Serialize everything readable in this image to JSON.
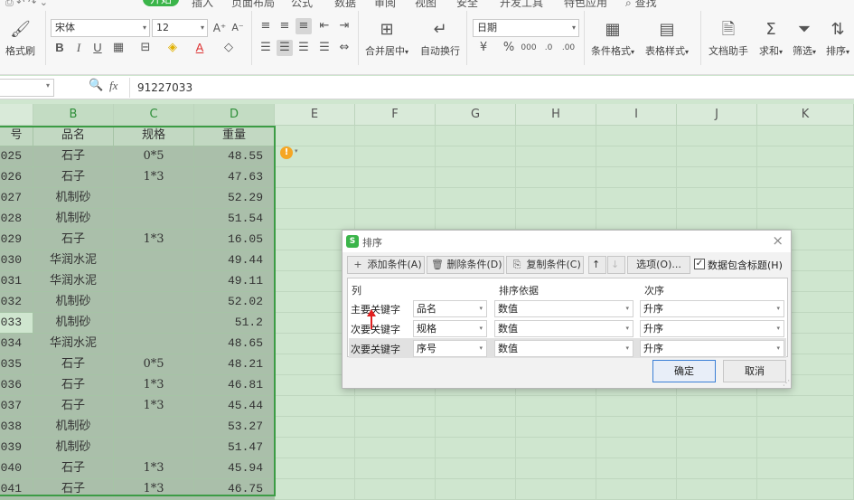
{
  "menu": {
    "tabs": [
      "开始",
      "插入",
      "页面布局",
      "公式",
      "数据",
      "审阅",
      "视图",
      "安全",
      "开发工具",
      "特色应用"
    ],
    "search": "查找"
  },
  "ribbon": {
    "format_painter": "格式刷",
    "font_name": "宋体",
    "font_size": "12",
    "merge_center": "合并居中",
    "wrap_text": "自动换行",
    "number_format": "日期",
    "conditional_format": "条件格式",
    "table_style": "表格样式",
    "doc_assistant": "文档助手",
    "sum": "求和",
    "filter": "筛选",
    "sort": "排序"
  },
  "formula_bar": {
    "fx": "fx",
    "value": "91227033"
  },
  "sheet": {
    "columns": [
      "B",
      "C",
      "D",
      "E",
      "F",
      "G",
      "H",
      "I",
      "J",
      "K"
    ],
    "headers": [
      "号",
      "品名",
      "规格",
      "重量"
    ],
    "rows": [
      [
        "025",
        "石子",
        "0*5",
        "48.55"
      ],
      [
        "026",
        "石子",
        "1*3",
        "47.63"
      ],
      [
        "027",
        "机制砂",
        "",
        "52.29"
      ],
      [
        "028",
        "机制砂",
        "",
        "51.54"
      ],
      [
        "029",
        "石子",
        "1*3",
        "16.05"
      ],
      [
        "030",
        "华润水泥",
        "",
        "49.44"
      ],
      [
        "031",
        "华润水泥",
        "",
        "49.11"
      ],
      [
        "032",
        "机制砂",
        "",
        "52.02"
      ],
      [
        "033",
        "机制砂",
        "",
        "51.2"
      ],
      [
        "034",
        "华润水泥",
        "",
        "48.65"
      ],
      [
        "035",
        "石子",
        "0*5",
        "48.21"
      ],
      [
        "036",
        "石子",
        "1*3",
        "46.81"
      ],
      [
        "037",
        "石子",
        "1*3",
        "45.44"
      ],
      [
        "038",
        "机制砂",
        "",
        "53.27"
      ],
      [
        "039",
        "机制砂",
        "",
        "51.47"
      ],
      [
        "040",
        "石子",
        "1*3",
        "45.94"
      ],
      [
        "041",
        "石子",
        "1*3",
        "46.75"
      ]
    ]
  },
  "dialog": {
    "title": "排序",
    "logo": "S",
    "add_condition": "添加条件(A)",
    "delete_condition": "删除条件(D)",
    "copy_condition": "复制条件(C)",
    "options": "选项(O)...",
    "header_checkbox": "数据包含标题(H)",
    "col_headers": [
      "列",
      "排序依据",
      "次序"
    ],
    "conditions": [
      {
        "label": "主要关键字",
        "key": "品名",
        "basis": "数值",
        "order": "升序"
      },
      {
        "label": "次要关键字",
        "key": "规格",
        "basis": "数值",
        "order": "升序"
      },
      {
        "label": "次要关键字",
        "key": "序号",
        "basis": "数值",
        "order": "升序"
      }
    ],
    "ok": "确定",
    "cancel": "取消"
  }
}
